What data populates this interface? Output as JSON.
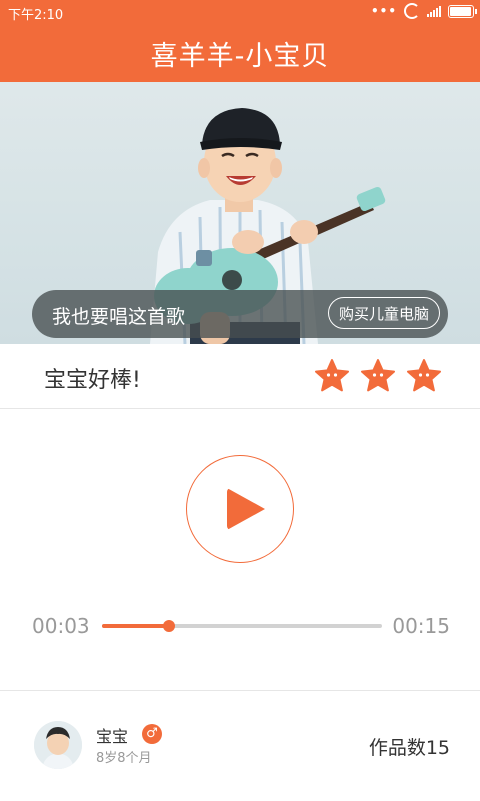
{
  "status_bar": {
    "time": "下午2:10",
    "dots": "•••"
  },
  "title": "喜羊羊-小宝贝",
  "hero": {
    "sing_label": "我也要唱这首歌",
    "buy_button": "购买儿童电脑"
  },
  "rating": {
    "text": "宝宝好棒!",
    "stars": 3,
    "star_icon": "star-face-icon"
  },
  "player": {
    "current_time": "00:03",
    "total_time": "00:15",
    "progress_fraction": 0.24
  },
  "user": {
    "name": "宝宝",
    "gender_symbol": "♂",
    "age": "8岁8个月",
    "works_label": "作品数15"
  },
  "colors": {
    "accent": "#f26b3a",
    "muted_text": "#999999",
    "track": "#d2d2d2"
  }
}
